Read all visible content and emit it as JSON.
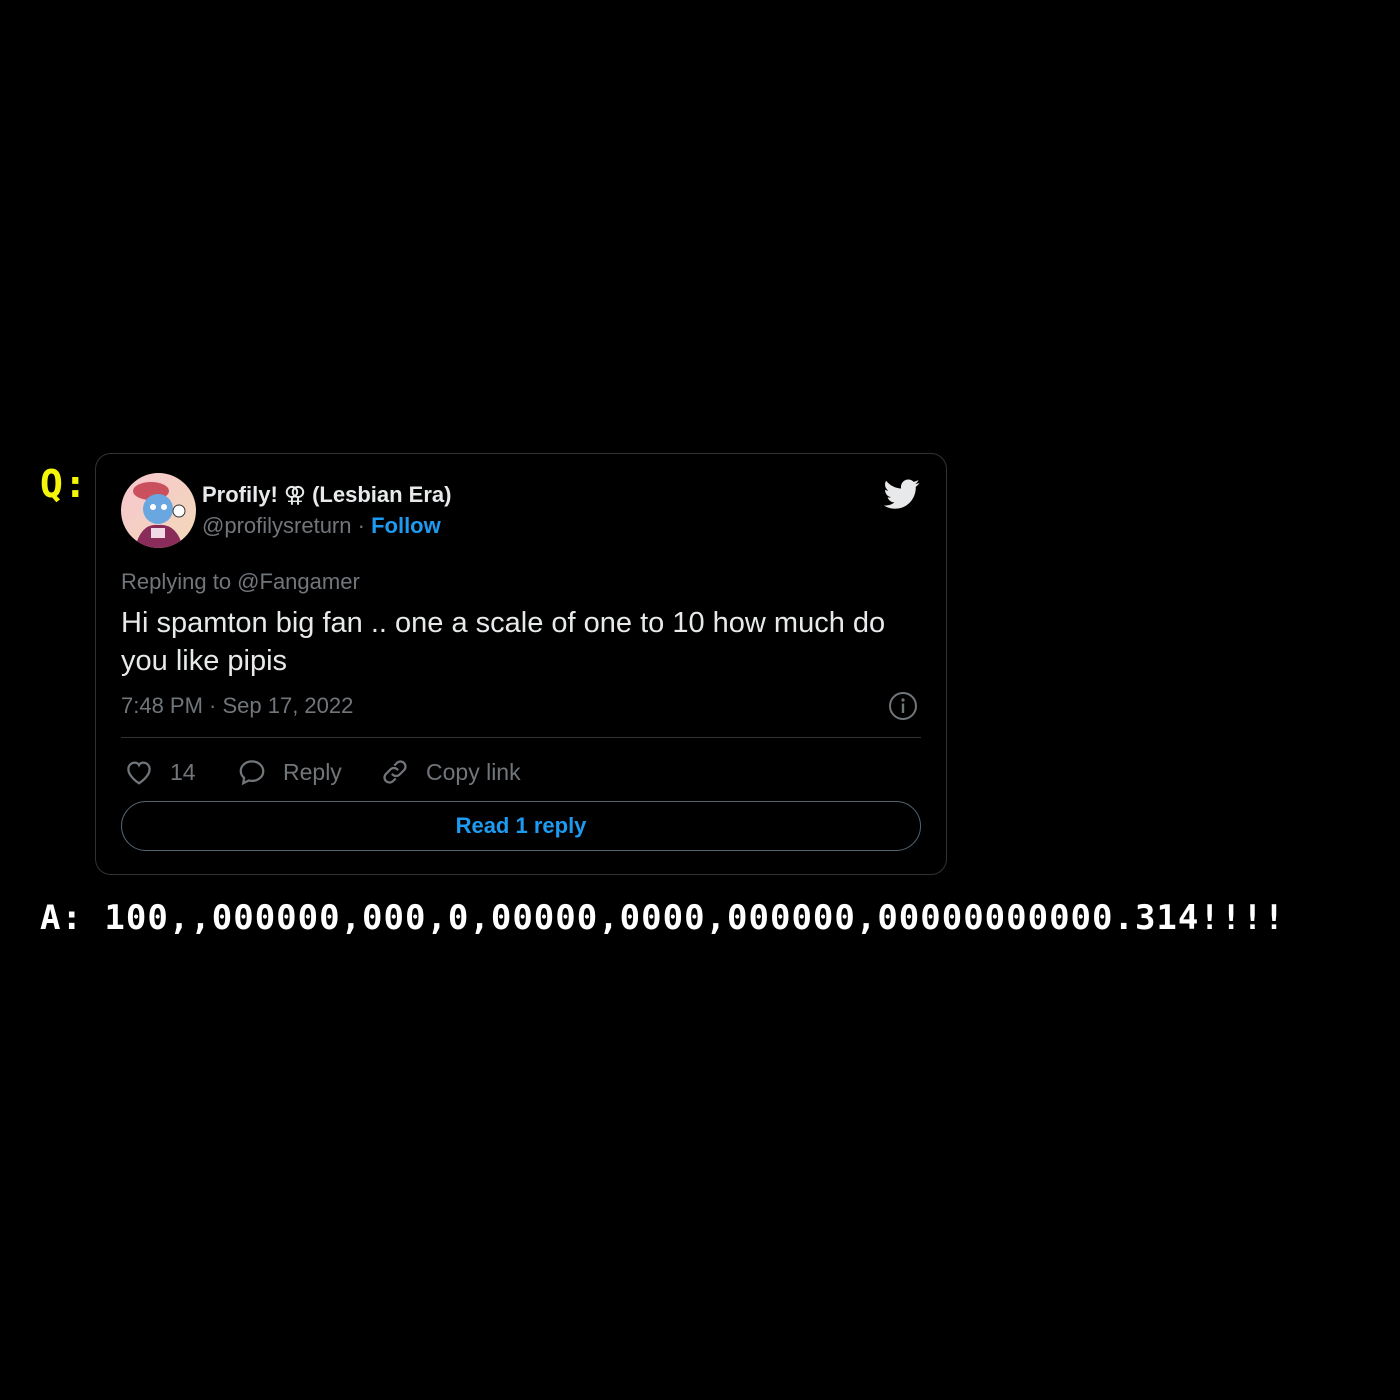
{
  "question_label": "Q:",
  "tweet": {
    "author_name": "Profily! ⚢ (Lesbian Era)",
    "handle": "@profilysreturn",
    "separator": "·",
    "follow_label": "Follow",
    "replying_to": "Replying to @Fangamer",
    "text": "Hi spamton big fan .. one a scale of one to 10 how much do you like pipis",
    "timestamp": "7:48 PM · Sep 17, 2022",
    "like_count": "14",
    "reply_label": "Reply",
    "copy_link_label": "Copy link",
    "read_replies_label": "Read 1 reply"
  },
  "answer": "A: 100,,000000,000,0,00000,0000,000000,00000000000.314!!!!",
  "icons": {
    "brand": "twitter-bird-icon",
    "info": "info-icon",
    "like": "heart-icon",
    "reply": "speech-bubble-icon",
    "copy": "link-icon"
  },
  "colors": {
    "background": "#000000",
    "question_label": "#f5f50a",
    "accent": "#1d9bf0",
    "secondary_text": "#71767b",
    "primary_text": "#e7e9ea"
  }
}
